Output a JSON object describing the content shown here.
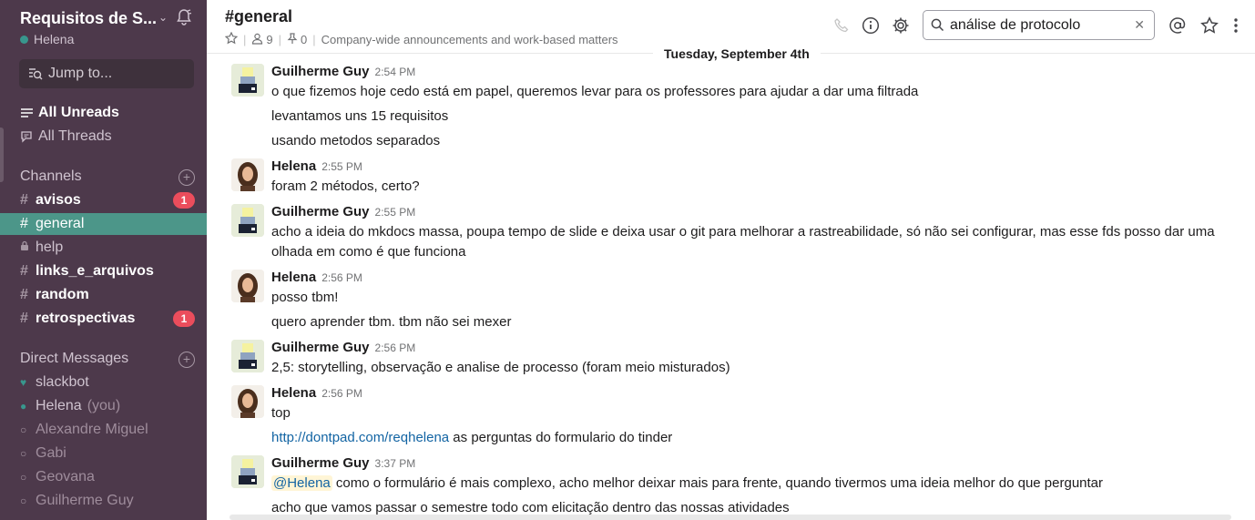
{
  "sidebar": {
    "team_name": "Requisitos de S...",
    "user_name": "Helena",
    "jump_label": "Jump to...",
    "all_unreads": "All Unreads",
    "all_threads": "All Threads",
    "channels_title": "Channels",
    "channels": [
      {
        "name": "avisos",
        "badge": "1"
      },
      {
        "name": "general"
      },
      {
        "name": "help"
      },
      {
        "name": "links_e_arquivos"
      },
      {
        "name": "random"
      },
      {
        "name": "retrospectivas",
        "badge": "1"
      }
    ],
    "dm_title": "Direct Messages",
    "dms": [
      {
        "name": "slackbot"
      },
      {
        "name": "Helena",
        "suffix": "(you)"
      },
      {
        "name": "Alexandre Miguel"
      },
      {
        "name": "Gabi"
      },
      {
        "name": "Geovana"
      },
      {
        "name": "Guilherme Guy"
      }
    ]
  },
  "header": {
    "channel_title": "#general",
    "member_count": "9",
    "pinned_count": "0",
    "topic": "Company-wide announcements and work-based matters",
    "search_value": "análise de protocolo",
    "icons": [
      "star-icon",
      "member-icon",
      "pin-icon",
      "phone-icon",
      "info-icon",
      "gear-icon",
      "search-icon",
      "close-icon",
      "at-icon",
      "star-outline-icon",
      "more-vertical-icon"
    ]
  },
  "messages": {
    "day_divider": "Tuesday, September 4th",
    "groups": [
      {
        "author": "Guilherme Guy",
        "time": "2:54 PM",
        "lines": [
          "o que fizemos hoje cedo está em papel, queremos levar para os professores para ajudar a dar uma filtrada",
          "levantamos uns 15 requisitos",
          "usando metodos separados"
        ]
      },
      {
        "author": "Helena",
        "time": "2:55 PM",
        "lines": [
          "foram 2 métodos, certo?"
        ]
      },
      {
        "author": "Guilherme Guy",
        "time": "2:55 PM",
        "lines": [
          "acho a ideia do mkdocs massa, poupa tempo de slide e deixa usar o git para melhorar a rastreabilidade, só não sei configurar, mas esse fds posso dar uma olhada em como é que funciona"
        ]
      },
      {
        "author": "Helena",
        "time": "2:56 PM",
        "lines": [
          "posso tbm!",
          "quero aprender tbm. tbm não sei mexer"
        ]
      },
      {
        "author": "Guilherme Guy",
        "time": "2:56 PM",
        "lines": [
          "2,5: storytelling, observação e analise de processo (foram meio misturados)"
        ]
      },
      {
        "author": "Helena",
        "time": "2:56 PM",
        "lines": [
          "top"
        ],
        "link": "http://dontpad.com/reqhelena",
        "link_tail": " as perguntas do formulario do tinder"
      },
      {
        "author": "Guilherme Guy",
        "time": "3:37 PM",
        "mention": "@Helena",
        "mention_tail": " como o formulário é mais complexo, acho melhor deixar mais para frente, quando tivermos uma ideia melhor do que perguntar",
        "lines": [
          "acho que vamos passar o semestre todo com elicitação dentro das nossas atividades"
        ]
      }
    ]
  }
}
